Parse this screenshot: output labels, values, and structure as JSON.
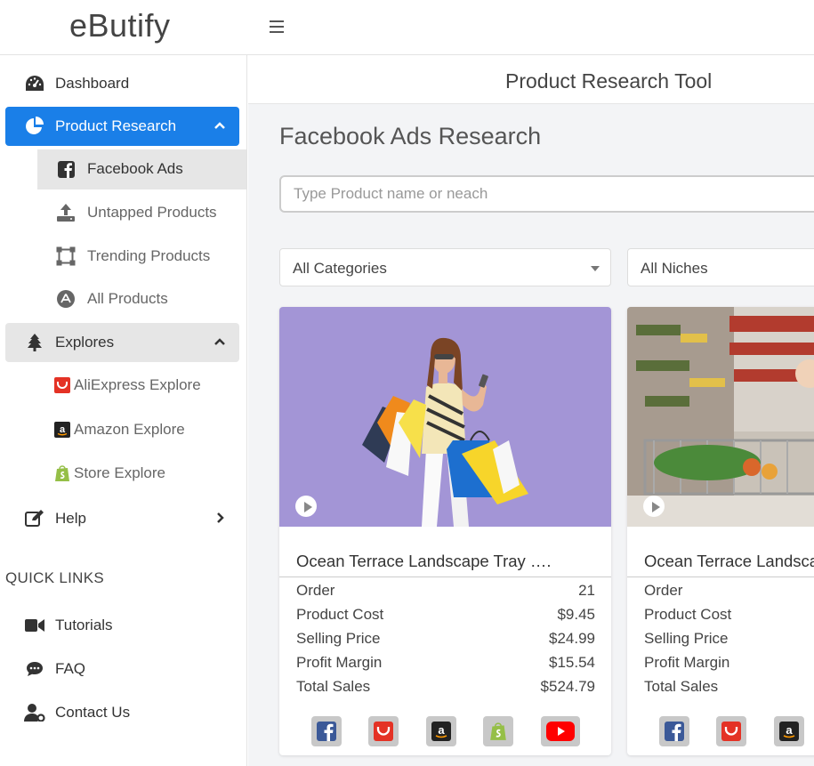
{
  "brand": "eButify",
  "sidebar": {
    "items": {
      "dashboard": "Dashboard",
      "product_research": "Product Research",
      "facebook_ads": "Facebook Ads",
      "untapped": "Untapped Products",
      "trending": "Trending Products",
      "all_products": "All Products",
      "explores": "Explores",
      "aliexpress": "AliExpress Explore",
      "amazon": "Amazon Explore",
      "store": "Store Explore",
      "help": "Help"
    },
    "quick_links_title": "QUICK LINKS",
    "quick_links": {
      "tutorials": "Tutorials",
      "faq": "FAQ",
      "contact": "Contact Us"
    }
  },
  "main": {
    "header_title": "Product Research Tool",
    "section_title": "Facebook Ads Research",
    "search_placeholder": "Type Product name or neach",
    "category_select": "All Categories",
    "niche_select": "All Niches"
  },
  "cards": [
    {
      "title": "Ocean Terrace Landscape Tray ….",
      "rows": {
        "order": {
          "label": "Order",
          "value": "21"
        },
        "product_cost": {
          "label": "Product Cost",
          "value": "$9.45"
        },
        "selling_price": {
          "label": "Selling Price",
          "value": "$24.99"
        },
        "profit_margin": {
          "label": "Profit Margin",
          "value": "$15.54"
        },
        "total_sales": {
          "label": "Total Sales",
          "value": "$524.79"
        }
      }
    },
    {
      "title": "Ocean Terrace Landscape Tray ….",
      "rows": {
        "order": {
          "label": "Order"
        },
        "product_cost": {
          "label": "Product Cost"
        },
        "selling_price": {
          "label": "Selling Price"
        },
        "profit_margin": {
          "label": "Profit Margin"
        },
        "total_sales": {
          "label": "Total Sales"
        }
      }
    }
  ],
  "colors": {
    "accent": "#1a7fe8",
    "facebook": "#3b5998",
    "aliexpress": "#e43225",
    "shopify": "#95bf47",
    "youtube": "#ff0000"
  }
}
